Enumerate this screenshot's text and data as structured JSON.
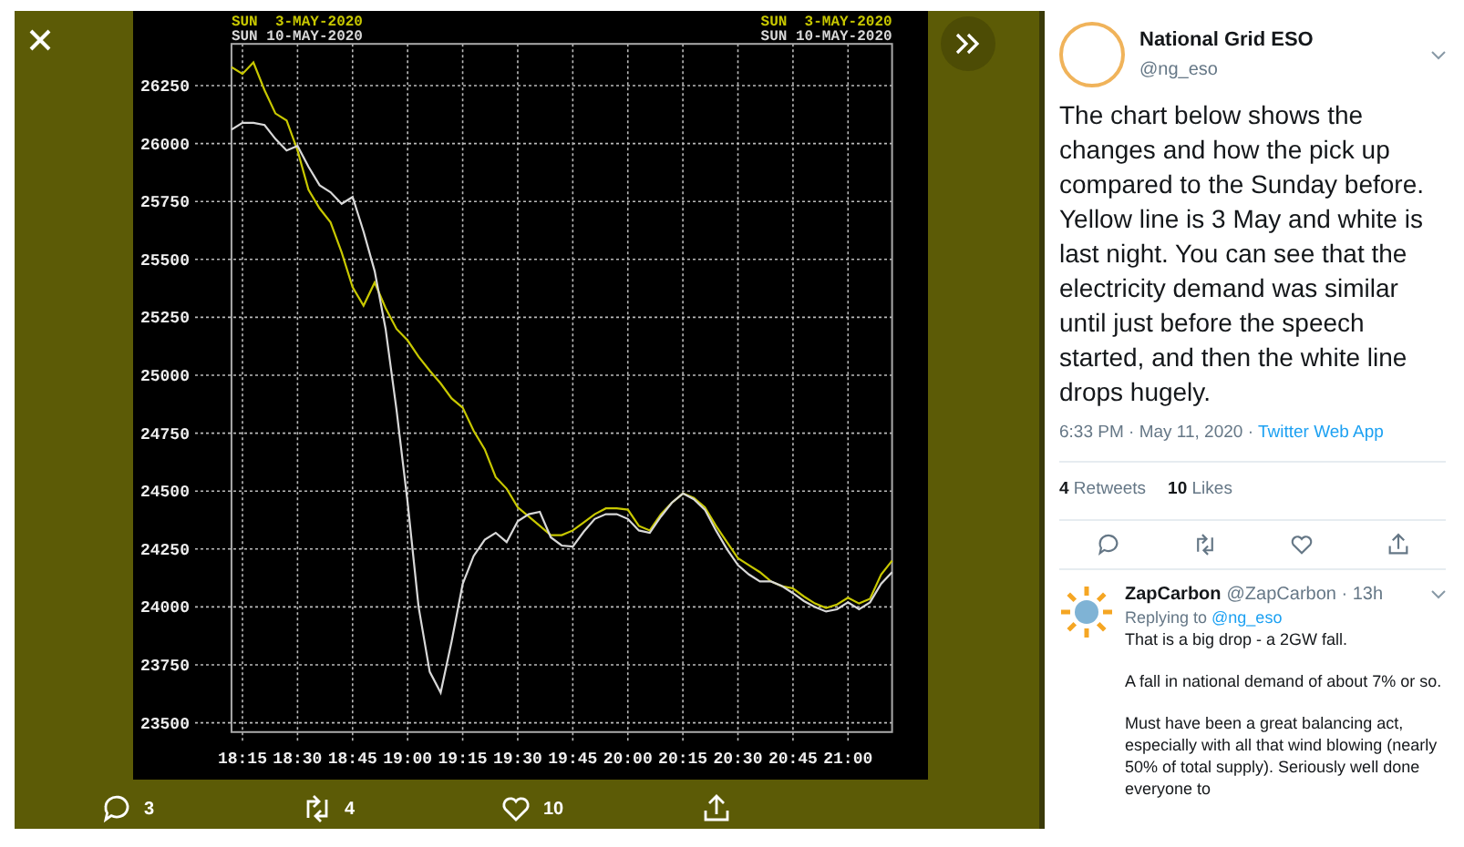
{
  "lightbox": {
    "actions": [
      {
        "kind": "reply",
        "count": "3"
      },
      {
        "kind": "retweet",
        "count": "4"
      },
      {
        "kind": "like",
        "count": "10"
      },
      {
        "kind": "share"
      }
    ]
  },
  "image": {
    "chart_data": {
      "type": "line",
      "grid": true,
      "ylim": [
        23460,
        26430
      ],
      "categories": [
        null,
        "18:15",
        null,
        null,
        null,
        null,
        "18:30",
        null,
        null,
        null,
        null,
        "18:45",
        null,
        null,
        null,
        null,
        "19:00",
        null,
        null,
        null,
        null,
        "19:15",
        null,
        null,
        null,
        null,
        "19:30",
        null,
        null,
        null,
        null,
        "19:45",
        null,
        null,
        null,
        null,
        "20:00",
        null,
        null,
        null,
        null,
        "20:15",
        null,
        null,
        null,
        null,
        "20:30",
        null,
        null,
        null,
        null,
        "20:45",
        null,
        null,
        null,
        null,
        "21:00",
        null,
        null,
        null,
        null
      ],
      "yticks": [
        {
          "value": 23500,
          "label": "23500"
        },
        {
          "value": 23750,
          "label": "23750"
        },
        {
          "value": 24000,
          "label": "24000"
        },
        {
          "value": 24250,
          "label": "24250"
        },
        {
          "value": 24500,
          "label": "24500"
        },
        {
          "value": 24750,
          "label": "24750"
        },
        {
          "value": 25000,
          "label": "25000"
        },
        {
          "value": 25250,
          "label": "25250"
        },
        {
          "value": 25500,
          "label": "25500"
        },
        {
          "value": 25750,
          "label": "25750"
        },
        {
          "value": 26000,
          "label": "26000"
        },
        {
          "value": 26250,
          "label": "26250"
        }
      ],
      "series": [
        {
          "name": "SUN  3-MAY-2020",
          "color": "#c8c800",
          "values": [
            26330,
            26300,
            26350,
            26230,
            26130,
            26100,
            25970,
            25800,
            25720,
            25660,
            25530,
            25380,
            25300,
            25400,
            25290,
            25200,
            25150,
            25080,
            25020,
            24965,
            24900,
            24860,
            24760,
            24680,
            24560,
            24510,
            24430,
            24390,
            24350,
            24310,
            24310,
            24330,
            24365,
            24400,
            24425,
            24425,
            24420,
            24350,
            24330,
            24400,
            24450,
            24490,
            24470,
            24430,
            24350,
            24280,
            24210,
            24180,
            24150,
            24110,
            24090,
            24080,
            24045,
            24015,
            23995,
            24010,
            24040,
            24015,
            24035,
            24140,
            24200
          ]
        },
        {
          "name": "SUN 10-MAY-2020",
          "color": "#d8d8d8",
          "values": [
            26060,
            26090,
            26090,
            26080,
            26020,
            25970,
            25990,
            25900,
            25820,
            25790,
            25740,
            25770,
            25620,
            25450,
            25200,
            24850,
            24450,
            24000,
            23720,
            23630,
            23850,
            24100,
            24220,
            24290,
            24320,
            24280,
            24370,
            24400,
            24410,
            24300,
            24265,
            24260,
            24325,
            24380,
            24400,
            24400,
            24380,
            24330,
            24320,
            24390,
            24450,
            24490,
            24465,
            24420,
            24330,
            24250,
            24180,
            24140,
            24110,
            24110,
            24090,
            24060,
            24025,
            24000,
            23980,
            23990,
            24020,
            23990,
            24020,
            24100,
            24150
          ]
        }
      ]
    },
    "right_legend": [
      "SUN  3-MAY-2020",
      "SUN 10-MAY-2020"
    ]
  },
  "tweet": {
    "name": "National Grid ESO",
    "handle": "@ng_eso",
    "text": "The chart below shows the changes and how the pick up compared to the Sunday before. Yellow line is 3 May and white is last night. You can see that the electricity demand was similar until just before the speech started, and then the white line drops hugely.",
    "time": "6:33 PM · May 11, 2020 · ",
    "source": "Twitter Web App",
    "retweets": "4",
    "retweets_label": "Retweets",
    "likes": "10",
    "likes_label": "Likes"
  },
  "reply": {
    "name": "ZapCarbon",
    "handle": "@ZapCarbon · 13h",
    "replying_to": "Replying to",
    "mention": "@ng_eso",
    "paragraphs": [
      "That is a big drop - a 2GW fall.",
      "A fall in national demand of about 7% or so.",
      "Must have been a great balancing act, especially with all that wind blowing (nearly 50% of total supply). Seriously well done everyone to"
    ]
  }
}
